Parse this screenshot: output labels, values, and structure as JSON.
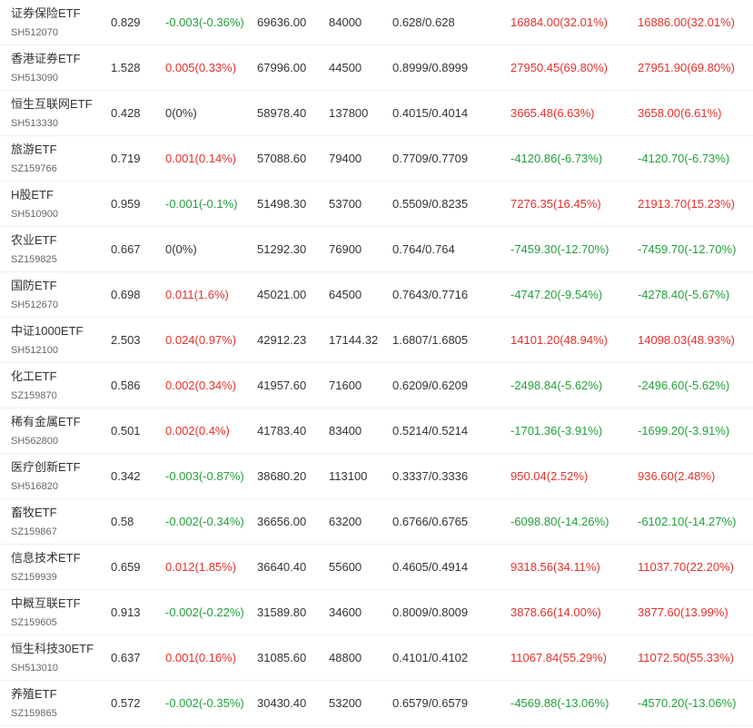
{
  "rows": [
    {
      "name": "证券保险ETF",
      "code": "SH512070",
      "price": "0.829",
      "change": "-0.003(-0.36%)",
      "change_dir": "down",
      "amount": "69636.00",
      "volume": "84000",
      "nav": "0.628/0.628",
      "premium1": "16884.00(32.01%)",
      "p1_dir": "up",
      "premium2": "16886.00(32.01%)",
      "p2_dir": "up"
    },
    {
      "name": "香港证券ETF",
      "code": "SH513090",
      "price": "1.528",
      "change": "0.005(0.33%)",
      "change_dir": "up",
      "amount": "67996.00",
      "volume": "44500",
      "nav": "0.8999/0.8999",
      "premium1": "27950.45(69.80%)",
      "p1_dir": "up",
      "premium2": "27951.90(69.80%)",
      "p2_dir": "up"
    },
    {
      "name": "恒生互联网ETF",
      "code": "SH513330",
      "price": "0.428",
      "change": "0(0%)",
      "change_dir": "flat",
      "amount": "58978.40",
      "volume": "137800",
      "nav": "0.4015/0.4014",
      "premium1": "3665.48(6.63%)",
      "p1_dir": "up",
      "premium2": "3658.00(6.61%)",
      "p2_dir": "up"
    },
    {
      "name": "旅游ETF",
      "code": "SZ159766",
      "price": "0.719",
      "change": "0.001(0.14%)",
      "change_dir": "up",
      "amount": "57088.60",
      "volume": "79400",
      "nav": "0.7709/0.7709",
      "premium1": "-4120.86(-6.73%)",
      "p1_dir": "down",
      "premium2": "-4120.70(-6.73%)",
      "p2_dir": "down"
    },
    {
      "name": "H股ETF",
      "code": "SH510900",
      "price": "0.959",
      "change": "-0.001(-0.1%)",
      "change_dir": "down",
      "amount": "51498.30",
      "volume": "53700",
      "nav": "0.5509/0.8235",
      "premium1": "7276.35(16.45%)",
      "p1_dir": "up",
      "premium2": "21913.70(15.23%)",
      "p2_dir": "up"
    },
    {
      "name": "农业ETF",
      "code": "SZ159825",
      "price": "0.667",
      "change": "0(0%)",
      "change_dir": "flat",
      "amount": "51292.30",
      "volume": "76900",
      "nav": "0.764/0.764",
      "premium1": "-7459.30(-12.70%)",
      "p1_dir": "down",
      "premium2": "-7459.70(-12.70%)",
      "p2_dir": "down"
    },
    {
      "name": "国防ETF",
      "code": "SH512670",
      "price": "0.698",
      "change": "0.011(1.6%)",
      "change_dir": "up",
      "amount": "45021.00",
      "volume": "64500",
      "nav": "0.7643/0.7716",
      "premium1": "-4747.20(-9.54%)",
      "p1_dir": "down",
      "premium2": "-4278.40(-5.67%)",
      "p2_dir": "down"
    },
    {
      "name": "中证1000ETF",
      "code": "SH512100",
      "price": "2.503",
      "change": "0.024(0.97%)",
      "change_dir": "up",
      "amount": "42912.23",
      "volume": "17144.32",
      "nav": "1.6807/1.6805",
      "premium1": "14101.20(48.94%)",
      "p1_dir": "up",
      "premium2": "14098.03(48.93%)",
      "p2_dir": "up"
    },
    {
      "name": "化工ETF",
      "code": "SZ159870",
      "price": "0.586",
      "change": "0.002(0.34%)",
      "change_dir": "up",
      "amount": "41957.60",
      "volume": "71600",
      "nav": "0.6209/0.6209",
      "premium1": "-2498.84(-5.62%)",
      "p1_dir": "down",
      "premium2": "-2496.60(-5.62%)",
      "p2_dir": "down"
    },
    {
      "name": "稀有金属ETF",
      "code": "SH562800",
      "price": "0.501",
      "change": "0.002(0.4%)",
      "change_dir": "up",
      "amount": "41783.40",
      "volume": "83400",
      "nav": "0.5214/0.5214",
      "premium1": "-1701.36(-3.91%)",
      "p1_dir": "down",
      "premium2": "-1699.20(-3.91%)",
      "p2_dir": "down"
    },
    {
      "name": "医疗创新ETF",
      "code": "SH516820",
      "price": "0.342",
      "change": "-0.003(-0.87%)",
      "change_dir": "down",
      "amount": "38680.20",
      "volume": "113100",
      "nav": "0.3337/0.3336",
      "premium1": "950.04(2.52%)",
      "p1_dir": "up",
      "premium2": "936.60(2.48%)",
      "p2_dir": "up"
    },
    {
      "name": "畜牧ETF",
      "code": "SZ159867",
      "price": "0.58",
      "change": "-0.002(-0.34%)",
      "change_dir": "down",
      "amount": "36656.00",
      "volume": "63200",
      "nav": "0.6766/0.6765",
      "premium1": "-6098.80(-14.26%)",
      "p1_dir": "down",
      "premium2": "-6102.10(-14.27%)",
      "p2_dir": "down"
    },
    {
      "name": "信息技术ETF",
      "code": "SZ159939",
      "price": "0.659",
      "change": "0.012(1.85%)",
      "change_dir": "up",
      "amount": "36640.40",
      "volume": "55600",
      "nav": "0.4605/0.4914",
      "premium1": "9318.56(34.11%)",
      "p1_dir": "up",
      "premium2": "11037.70(22.20%)",
      "p2_dir": "up"
    },
    {
      "name": "中概互联ETF",
      "code": "SZ159605",
      "price": "0.913",
      "change": "-0.002(-0.22%)",
      "change_dir": "down",
      "amount": "31589.80",
      "volume": "34600",
      "nav": "0.8009/0.8009",
      "premium1": "3878.66(14.00%)",
      "p1_dir": "up",
      "premium2": "3877.60(13.99%)",
      "p2_dir": "up"
    },
    {
      "name": "恒生科技30ETF",
      "code": "SH513010",
      "price": "0.637",
      "change": "0.001(0.16%)",
      "change_dir": "up",
      "amount": "31085.60",
      "volume": "48800",
      "nav": "0.4101/0.4102",
      "premium1": "11067.84(55.29%)",
      "p1_dir": "up",
      "premium2": "11072.50(55.33%)",
      "p2_dir": "up"
    },
    {
      "name": "养殖ETF",
      "code": "SZ159865",
      "price": "0.572",
      "change": "-0.002(-0.35%)",
      "change_dir": "down",
      "amount": "30430.40",
      "volume": "53200",
      "nav": "0.6579/0.6579",
      "premium1": "-4569.88(-13.06%)",
      "p1_dir": "down",
      "premium2": "-4570.20(-13.06%)",
      "p2_dir": "down"
    }
  ],
  "colors": {
    "up": "#e5312b",
    "down": "#23a03c",
    "flat": "#333333",
    "divider": "#eeeeee"
  }
}
